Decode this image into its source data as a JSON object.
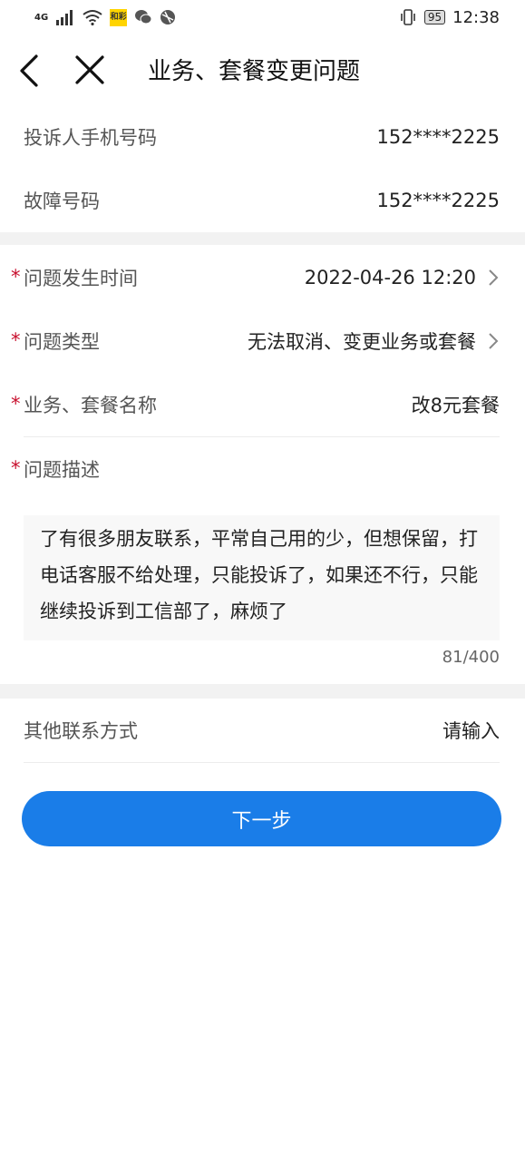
{
  "status_bar": {
    "network": "4G",
    "app_badge": "和彩",
    "battery": "95",
    "time": "12:38"
  },
  "header": {
    "title": "业务、套餐变更问题"
  },
  "fields": {
    "complainant_phone": {
      "label": "投诉人手机号码",
      "value": "152****2225"
    },
    "fault_number": {
      "label": "故障号码",
      "value": "152****2225"
    },
    "issue_time": {
      "label": "问题发生时间",
      "value": "2022-04-26 12:20"
    },
    "issue_type": {
      "label": "问题类型",
      "value": "无法取消、变更业务或套餐"
    },
    "plan_name": {
      "label": "业务、套餐名称",
      "value": "改8元套餐"
    },
    "description": {
      "label": "问题描述",
      "text": "了有很多朋友联系，平常自己用的少，但想保留，打电话客服不给处理，只能投诉了，如果还不行，只能继续投诉到工信部了，麻烦了",
      "counter": "81/400"
    },
    "other_contact": {
      "label": "其他联系方式",
      "placeholder": "请输入"
    }
  },
  "required_mark": "*",
  "next_button": {
    "label": "下一步"
  },
  "colors": {
    "primary": "#1a7de8",
    "required": "#c8102e",
    "section_gap": "#f2f2f2"
  }
}
